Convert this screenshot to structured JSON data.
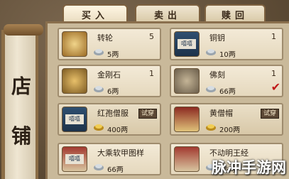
{
  "tabs": {
    "buy": "买入",
    "sell": "卖出",
    "redeem": "赎回"
  },
  "shop_title": [
    "店",
    "铺"
  ],
  "items": [
    {
      "name": "转轮",
      "count": "5",
      "price": "5两",
      "badge": ""
    },
    {
      "name": "铜钥",
      "count": "1",
      "price": "10两",
      "badge": "嘻嘻"
    },
    {
      "name": "金刚石",
      "count": "1",
      "price": "6两",
      "badge": ""
    },
    {
      "name": "佛刻",
      "count": "1",
      "price": "66两",
      "badge": ""
    },
    {
      "name": "红孢僧服",
      "count": "",
      "price": "400两",
      "badge": "嘻嘻",
      "try": "试穿"
    },
    {
      "name": "黄僧帽",
      "count": "",
      "price": "200两",
      "badge": "",
      "try": "试穿"
    },
    {
      "name": "大乘软甲图样",
      "count": "",
      "price": "66两",
      "badge": "嘻嘻"
    },
    {
      "name": "不动明王经",
      "count": "",
      "price": "66两",
      "badge": ""
    }
  ],
  "watermark": "脉冲手游网",
  "colors": {
    "accent": "#c01818"
  }
}
